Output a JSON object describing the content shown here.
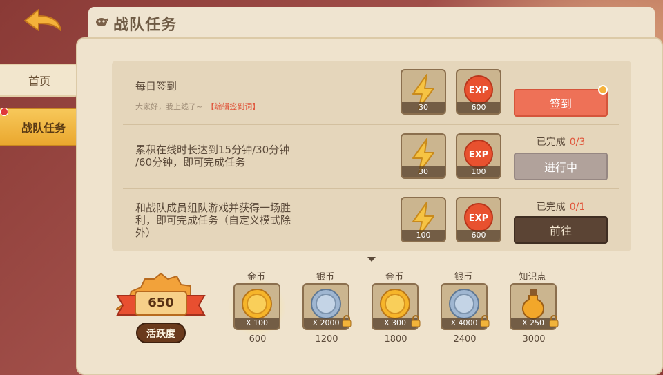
{
  "header": {
    "title": "战队任务"
  },
  "sidebar": {
    "items": [
      {
        "label": "首页"
      },
      {
        "label": "战队任务"
      }
    ]
  },
  "tasks": [
    {
      "title": "每日签到",
      "subtitle": "大家好，我上线了~",
      "edit_label": "【编辑签到词】",
      "rewards": [
        {
          "icon": "lightning-icon",
          "value": "30"
        },
        {
          "icon": "exp-icon",
          "value": "600"
        }
      ],
      "button": "签到"
    },
    {
      "title_line1": "累积在线时长达到15分钟/30分钟",
      "title_line2": "/60分钟，即可完成任务",
      "rewards": [
        {
          "icon": "lightning-icon",
          "value": "30"
        },
        {
          "icon": "exp-icon",
          "value": "100"
        }
      ],
      "status_label": "已完成",
      "status_count": "0/3",
      "button": "进行中"
    },
    {
      "title_line1": "和战队成员组队游戏并获得一场胜",
      "title_line2": "利，即可完成任务（自定义模式除",
      "title_line3": "外）",
      "rewards": [
        {
          "icon": "lightning-icon",
          "value": "100"
        },
        {
          "icon": "exp-icon",
          "value": "600"
        }
      ],
      "status_label": "已完成",
      "status_count": "0/1",
      "button": "前往"
    }
  ],
  "activity": {
    "value": "650",
    "label": "活跃度",
    "chests": [
      {
        "title": "金币",
        "amount": "X 100",
        "threshold": "600",
        "icon": "gold-coin-icon",
        "locked": false
      },
      {
        "title": "银币",
        "amount": "X 2000",
        "threshold": "1200",
        "icon": "silver-coin-icon",
        "locked": true
      },
      {
        "title": "金币",
        "amount": "X 300",
        "threshold": "1800",
        "icon": "gold-coin-icon",
        "locked": true
      },
      {
        "title": "银币",
        "amount": "X 4000",
        "threshold": "2400",
        "icon": "silver-coin-icon",
        "locked": true
      },
      {
        "title": "知识点",
        "amount": "X 250",
        "threshold": "3000",
        "icon": "potion-icon",
        "locked": true
      }
    ]
  },
  "colors": {
    "primary_button": "#ee7157",
    "go_button": "#5b4434",
    "highlight": "#e0553b"
  }
}
